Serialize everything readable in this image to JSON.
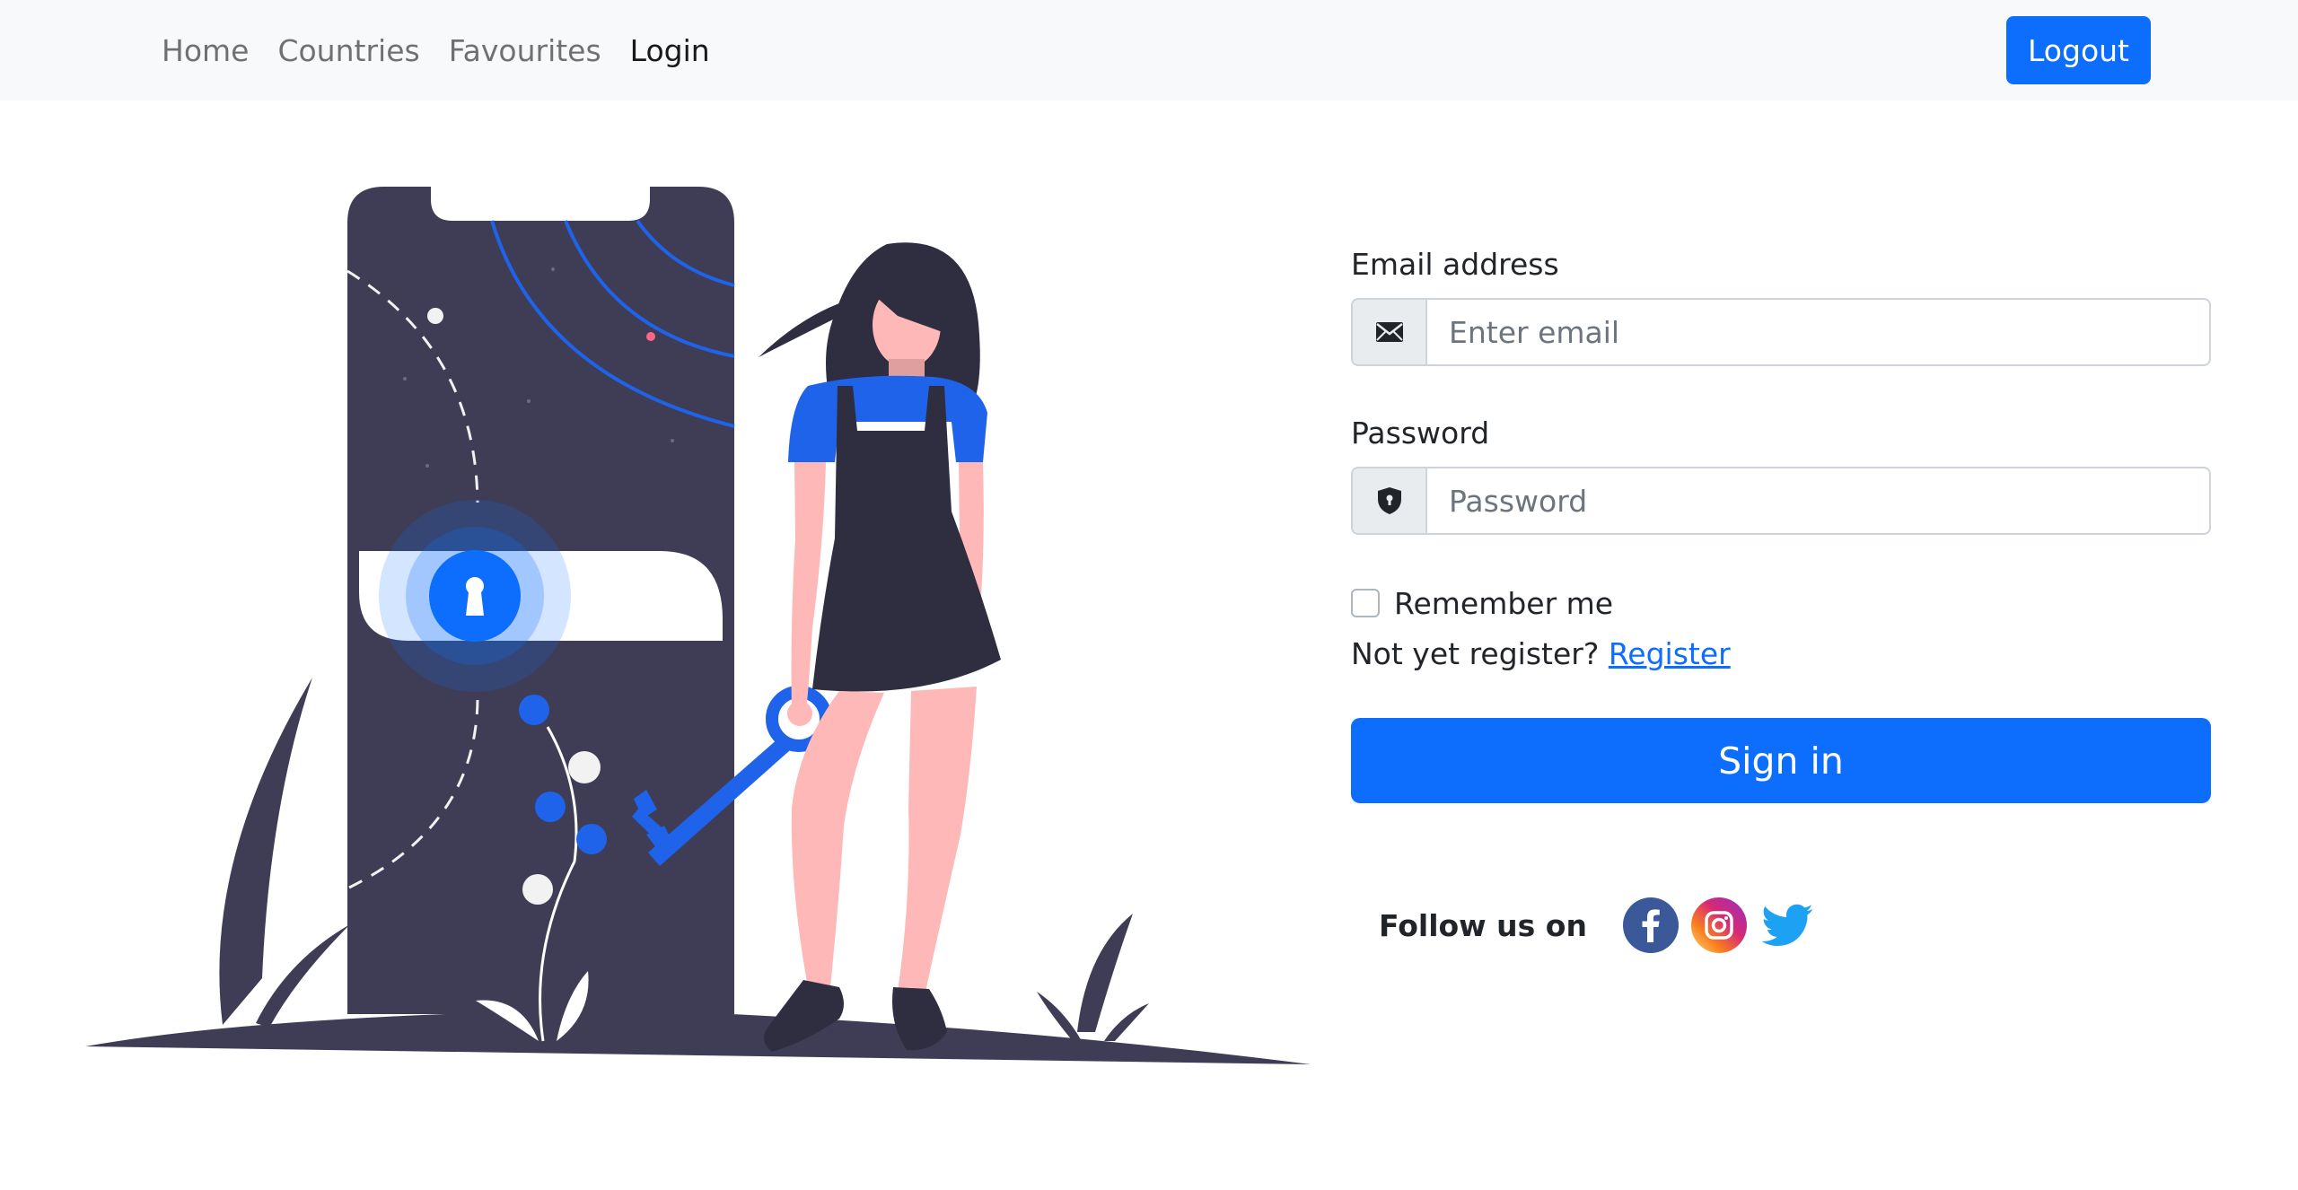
{
  "navbar": {
    "links": [
      {
        "label": "Home",
        "active": false
      },
      {
        "label": "Countries",
        "active": false
      },
      {
        "label": "Favourites",
        "active": false
      },
      {
        "label": "Login",
        "active": true
      }
    ],
    "logout_label": "Logout"
  },
  "form": {
    "email_label": "Email address",
    "email_placeholder": "Enter email",
    "email_value": "",
    "password_label": "Password",
    "password_placeholder": "Password",
    "password_value": "",
    "remember_label": "Remember me",
    "remember_checked": false,
    "register_prompt": "Not yet register?",
    "register_link": "Register",
    "signin_label": "Sign in"
  },
  "social": {
    "follow_text": "Follow us on",
    "icons": [
      "facebook-icon",
      "instagram-icon",
      "twitter-icon"
    ]
  },
  "colors": {
    "primary": "#0d6efd",
    "navbar_bg": "#f8f9fa",
    "illustration_dark": "#3f3d56",
    "skin": "#ffb8b8",
    "hair": "#2f2e41"
  }
}
